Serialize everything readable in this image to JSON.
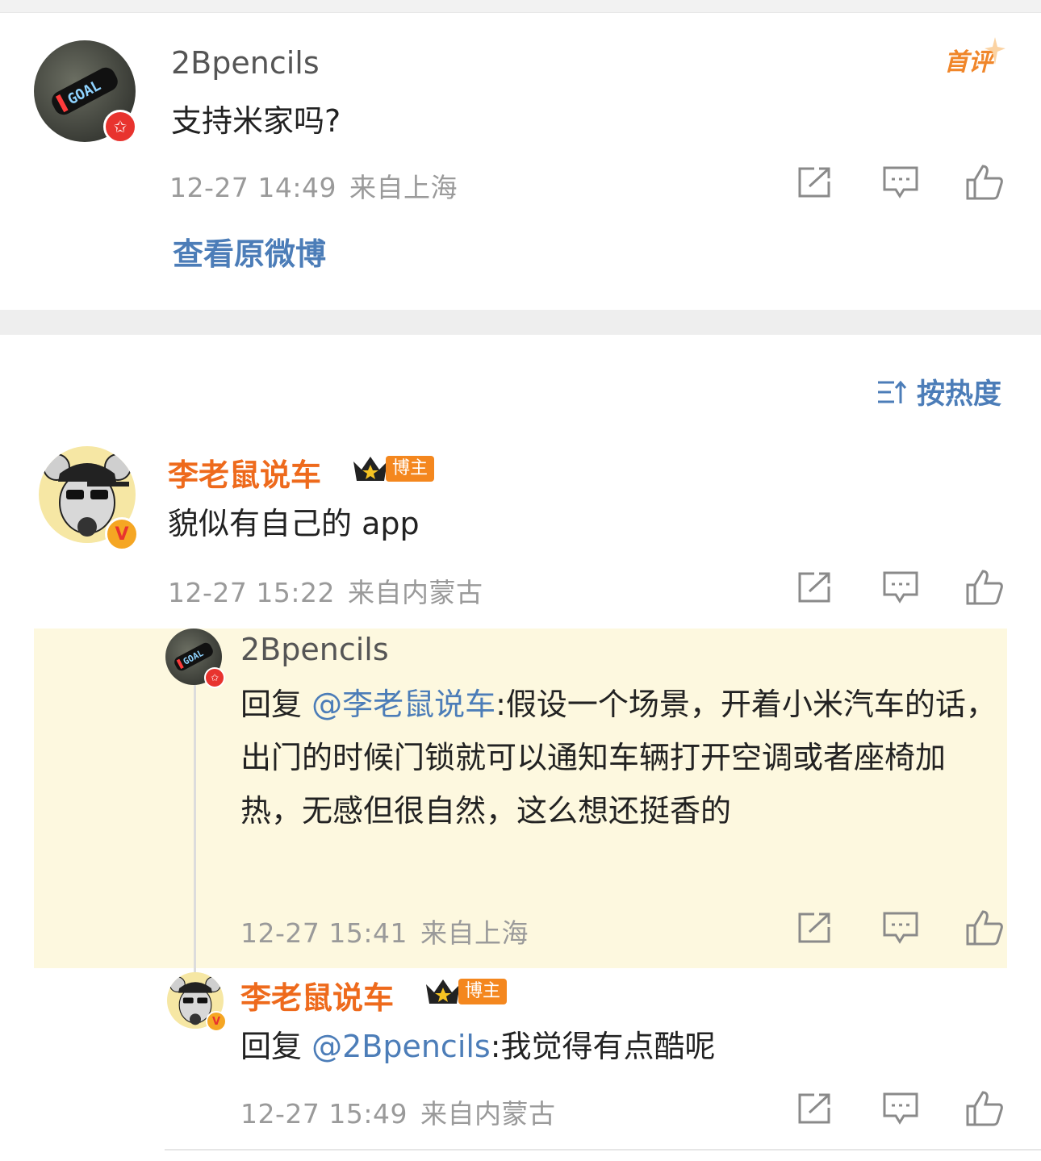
{
  "original_post": {
    "username": "2Bpencils",
    "text": "支持米家吗?",
    "time": "12-27 14:49",
    "location": "来自上海",
    "first_tag": "首评",
    "view_original": "查看原微博"
  },
  "sort": {
    "label": "按热度"
  },
  "comments": [
    {
      "username": "李老鼠说车",
      "badge": "博主",
      "text": "貌似有自己的 app",
      "time": "12-27 15:22",
      "location": "来自内蒙古"
    }
  ],
  "replies": [
    {
      "username": "2Bpencils",
      "reply_prefix": "回复 ",
      "mention": "@李老鼠说车",
      "text": ":假设一个场景，开着小米汽车的话，出门的时候门锁就可以通知车辆打开空调或者座椅加热，无感但很自然，这么想还挺香的",
      "time": "12-27 15:41",
      "location": "来自上海"
    },
    {
      "username": "李老鼠说车",
      "badge": "博主",
      "reply_prefix": "回复 ",
      "mention": "@2Bpencils",
      "text": ":我觉得有点酷呢",
      "time": "12-27 15:49",
      "location": "来自内蒙古"
    }
  ],
  "icons": [
    "share-icon",
    "comment-icon",
    "like-icon",
    "sort-icon",
    "verified-icon",
    "crown-icon"
  ],
  "colors": {
    "accent_blue": "#4c7db8",
    "orange_name": "#ee6a1c",
    "highlight_bg": "#fdf8df",
    "badge_red": "#e8332e"
  }
}
